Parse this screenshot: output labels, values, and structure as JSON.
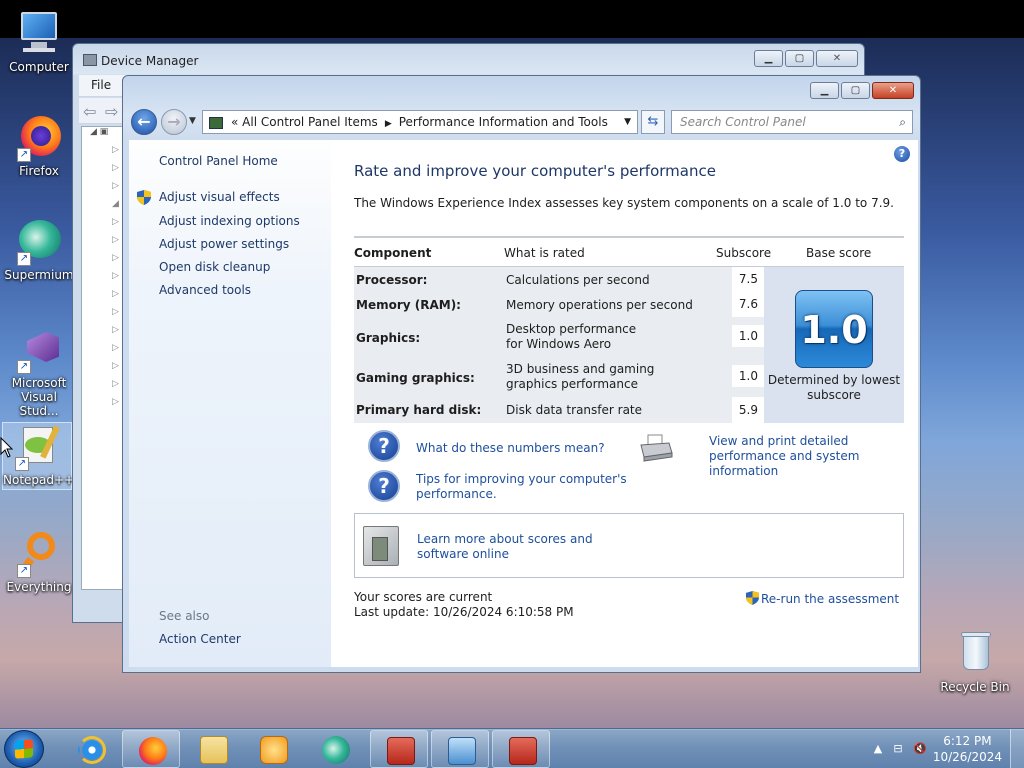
{
  "desktop": {
    "icons": [
      {
        "label": "Computer"
      },
      {
        "label": "Firefox"
      },
      {
        "label": "Supermium"
      },
      {
        "label": "Microsoft Visual Stud..."
      },
      {
        "label": "Notepad++"
      },
      {
        "label": "Everything"
      },
      {
        "label": "Recycle Bin"
      }
    ]
  },
  "device_manager": {
    "title": "Device Manager",
    "menu": [
      "File"
    ]
  },
  "window": {
    "address": {
      "crumb_prefix": "«",
      "crumb1": "All Control Panel Items",
      "crumb2": "Performance Information and Tools"
    },
    "search_placeholder": "Search Control Panel",
    "left_pane": {
      "home": "Control Panel Home",
      "links": [
        "Adjust visual effects",
        "Adjust indexing options",
        "Adjust power settings",
        "Open disk cleanup",
        "Advanced tools"
      ],
      "see_also_heading": "See also",
      "see_also": [
        "Action Center"
      ]
    },
    "content": {
      "heading": "Rate and improve your computer's performance",
      "intro": "The Windows Experience Index assesses key system components on a scale of 1.0 to 7.9.",
      "table": {
        "headers": {
          "component": "Component",
          "what": "What is rated",
          "subscore": "Subscore",
          "base": "Base score"
        },
        "rows": [
          {
            "component": "Processor:",
            "what": "Calculations per second",
            "subscore": "7.5"
          },
          {
            "component": "Memory (RAM):",
            "what": "Memory operations per second",
            "subscore": "7.6"
          },
          {
            "component": "Graphics:",
            "what": "Desktop performance for Windows Aero",
            "subscore": "1.0"
          },
          {
            "component": "Gaming graphics:",
            "what": "3D business and gaming graphics performance",
            "subscore": "1.0"
          },
          {
            "component": "Primary hard disk:",
            "what": "Disk data transfer rate",
            "subscore": "5.9"
          }
        ],
        "base_score": "1.0",
        "base_label": "Determined by lowest subscore"
      },
      "links": {
        "numbers": "What do these numbers mean?",
        "tips": "Tips for improving your computer's performance.",
        "print": "View and print detailed performance and system information",
        "learn": "Learn more about scores and software online"
      },
      "status": {
        "current": "Your scores are current",
        "last_update": "Last update: 10/26/2024 6:10:58 PM"
      },
      "rerun": "Re-run the assessment"
    }
  },
  "taskbar": {
    "clock_time": "6:12 PM",
    "clock_date": "10/26/2024"
  },
  "colors": {
    "link": "#1e4f9c",
    "heading": "#1e3767",
    "badge": "#2d8ad9"
  }
}
